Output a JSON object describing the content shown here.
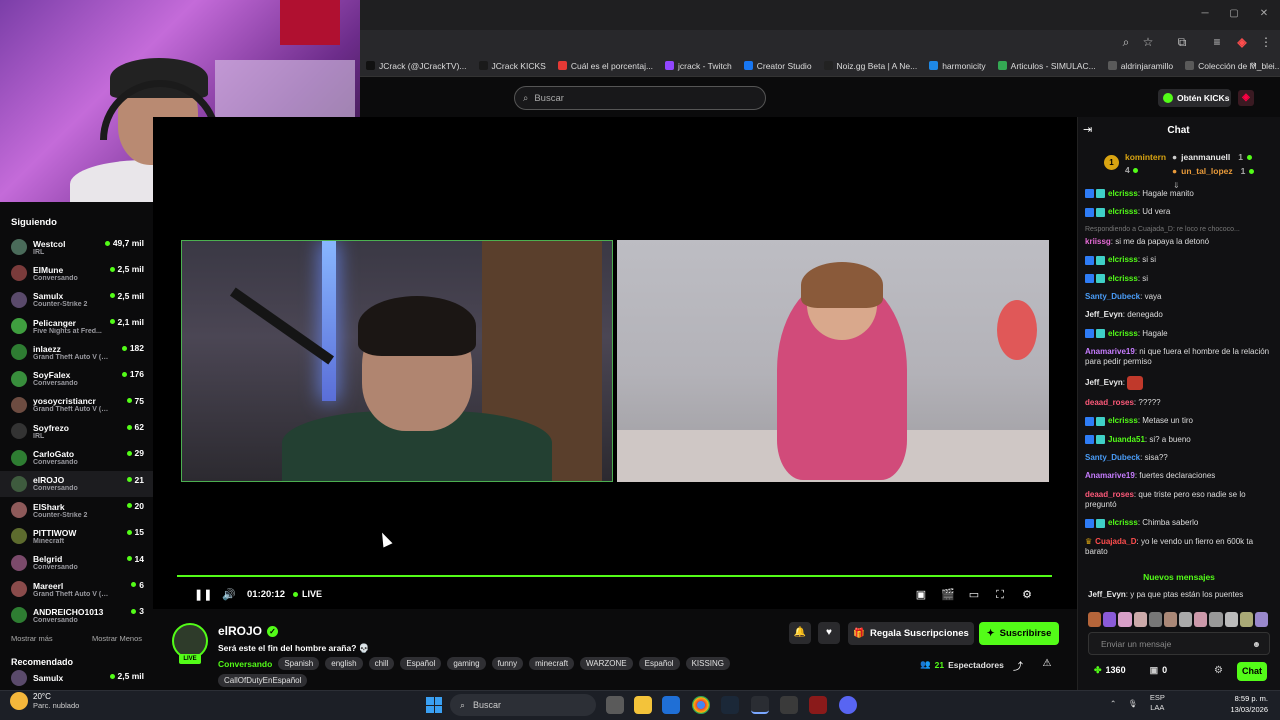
{
  "browser": {
    "bookmarks": [
      {
        "label": "JCrack (@JCrackTV)...",
        "color": "#111"
      },
      {
        "label": "JCrack KICKS",
        "color": "#1a1a1a"
      },
      {
        "label": "Cuál es el porcentaj...",
        "color": "#e53935"
      },
      {
        "label": "jcrack - Twitch",
        "color": "#9146ff"
      },
      {
        "label": "Creator Studio",
        "color": "#1877f2"
      },
      {
        "label": "Noiz.gg Beta | A Ne...",
        "color": "#222"
      },
      {
        "label": "harmonicity",
        "color": "#1e88e5"
      },
      {
        "label": "Articulos - SIMULAC...",
        "color": "#34a853"
      },
      {
        "label": "aldrinjaramillo",
        "color": "#5a5a5a"
      },
      {
        "label": "Colección de M_blei...",
        "color": "#5a5a5a"
      }
    ]
  },
  "topnav": {
    "search_placeholder": "Buscar",
    "kicks_button": "Obtén KICKs"
  },
  "sidebar": {
    "following_label": "Siguiendo",
    "channels": [
      {
        "name": "Westcol",
        "category": "IRL",
        "viewers": "49,7 mil",
        "color": "#4a6b5a"
      },
      {
        "name": "ElMune",
        "category": "Conversando",
        "viewers": "2,5 mil",
        "color": "#7a3b3b"
      },
      {
        "name": "Samulx",
        "category": "Counter-Strike 2",
        "viewers": "2,5 mil",
        "color": "#5a4a6b"
      },
      {
        "name": "Pelicanger",
        "category": "Five Nights at Fred...",
        "viewers": "2,1 mil",
        "color": "#3f9e3f"
      },
      {
        "name": "inlaezz",
        "category": "Grand Theft Auto V (G...",
        "viewers": "182",
        "color": "#2e7d32"
      },
      {
        "name": "SoyFalex",
        "category": "Conversando",
        "viewers": "176",
        "color": "#388e3c"
      },
      {
        "name": "yosoycristiancr",
        "category": "Grand Theft Auto V (GTA)",
        "viewers": "75",
        "color": "#6d4c41"
      },
      {
        "name": "Soyfrezo",
        "category": "IRL",
        "viewers": "62",
        "color": "#333"
      },
      {
        "name": "CarloGato",
        "category": "Conversando",
        "viewers": "29",
        "color": "#2e7d32"
      },
      {
        "name": "elROJO",
        "category": "Conversando",
        "viewers": "21",
        "color": "#3e5b3e"
      },
      {
        "name": "ElShark",
        "category": "Counter-Strike 2",
        "viewers": "20",
        "color": "#8e5a5a"
      },
      {
        "name": "PITTIWOW",
        "category": "Minecraft",
        "viewers": "15",
        "color": "#5d6b2e"
      },
      {
        "name": "Belgrid",
        "category": "Conversando",
        "viewers": "14",
        "color": "#7b4a6b"
      },
      {
        "name": "Mareerl",
        "category": "Grand Theft Auto V (GTA)",
        "viewers": "6",
        "color": "#8a4b4b"
      },
      {
        "name": "ANDREICHO1013",
        "category": "Conversando",
        "viewers": "3",
        "color": "#2e7d32"
      }
    ],
    "show_more": "Mostrar más",
    "show_less": "Mostrar Menos",
    "recommended_label": "Recomendado",
    "recommended": [
      {
        "name": "Samulx",
        "viewers": "2,5 mil"
      }
    ]
  },
  "player": {
    "time": "01:20:12",
    "live": "LIVE"
  },
  "stream": {
    "channel": "elROJO",
    "live_badge": "LIVE",
    "title": "Será este el fin del hombre araña? 💀",
    "category": "Conversando",
    "tags": [
      "Spanish",
      "english",
      "chill",
      "Español",
      "gaming",
      "funny",
      "minecraft",
      "WARZONE",
      "Español",
      "KISSING",
      "CallOfDutyEnEspañol"
    ],
    "gift_button": "Regala Suscripciones",
    "subscribe_button": "Suscribirse",
    "viewers": "21",
    "viewers_label": "Espectadores"
  },
  "chat": {
    "title": "Chat",
    "leaderboard": {
      "first": {
        "name": "komintern",
        "score": "4"
      },
      "second": {
        "name": "jeanmanuell",
        "score": "1"
      },
      "third": {
        "name": "un_tal_lopez",
        "score": "1"
      }
    },
    "messages": [
      {
        "user": "elcrisss",
        "text": "Hagale manito",
        "color": "#53fc18",
        "badges": true
      },
      {
        "user": "elcrisss",
        "text": "Ud vera",
        "color": "#53fc18",
        "badges": true
      },
      {
        "reply": "Respondiendo a Cuajada_D: re loco re chococo..."
      },
      {
        "user": "kriissg",
        "text": "si me da papaya la detonó",
        "color": "#e66bd6",
        "badges": false
      },
      {
        "user": "elcrisss",
        "text": "si si",
        "color": "#53fc18",
        "badges": true
      },
      {
        "user": "elcrisss",
        "text": "si",
        "color": "#53fc18",
        "badges": true
      },
      {
        "user": "Santy_Dubeck",
        "text": "vaya",
        "color": "#4a9df8",
        "badges": false
      },
      {
        "user": "Jeff_Evyn",
        "text": "denegado",
        "color": "#e8e8e8",
        "badges": false
      },
      {
        "user": "elcrisss",
        "text": "Hagale",
        "color": "#53fc18",
        "badges": true
      },
      {
        "user": "Anamarive19",
        "text": "ni que fuera el hombre de la relación para pedir permiso",
        "color": "#c77dff",
        "badges": false
      },
      {
        "user": "Jeff_Evyn",
        "text": "",
        "color": "#e8e8e8",
        "badges": false,
        "emote": true
      },
      {
        "user": "deaad_roses",
        "text": "?????",
        "color": "#ff5a7a",
        "badges": false
      },
      {
        "user": "elcrisss",
        "text": "Metase un tiro",
        "color": "#53fc18",
        "badges": true
      },
      {
        "user": "Juanda51",
        "text": "si? a bueno",
        "color": "#53fc18",
        "badges": true
      },
      {
        "user": "Santy_Dubeck",
        "text": "sisa??",
        "color": "#4a9df8",
        "badges": false
      },
      {
        "user": "Anamarive19",
        "text": "fuertes declaraciones",
        "color": "#c77dff",
        "badges": false
      },
      {
        "user": "deaad_roses",
        "text": "que triste pero eso nadie se lo preguntó",
        "color": "#ff5a7a",
        "badges": false
      },
      {
        "user": "elcrisss",
        "text": "Chimba saberlo",
        "color": "#53fc18",
        "badges": true
      },
      {
        "user": "Cuajada_D",
        "text": "yo le vendo un fierro en 600k ta barato",
        "color": "#ff4d4d",
        "badges": false,
        "crown": true
      }
    ],
    "new_messages": "Nuevos mensajes",
    "last_message": {
      "user": "Jeff_Evyn",
      "text": "y pa que ptas están los puentes"
    },
    "input_placeholder": "Enviar un mensaje",
    "points": "1360",
    "kicks": "0",
    "chat_button": "Chat"
  },
  "taskbar": {
    "temperature": "20°C",
    "weather": "Parc. nublado",
    "search": "Buscar",
    "lang": "ESP",
    "lang2": "LAA",
    "time": "8:59 p. m.",
    "date": "13/03/2026"
  }
}
